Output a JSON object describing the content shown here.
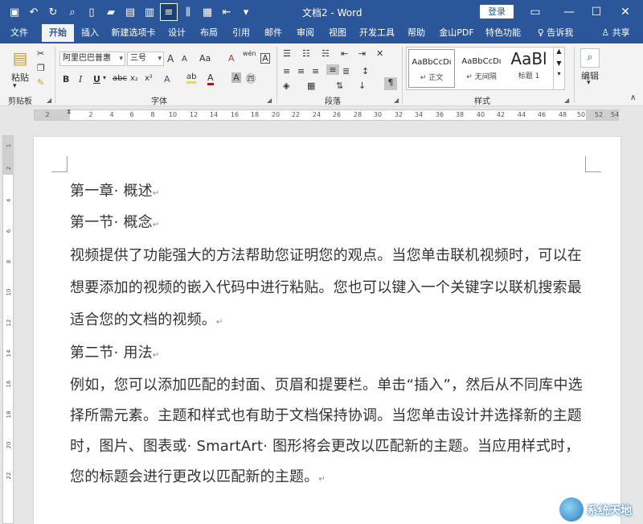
{
  "title_bar": {
    "doc_title": "文档2 - Word",
    "login_label": "登录",
    "restore_icon": "▭",
    "minimize_icon": "—",
    "maximize_icon": "☐",
    "close_icon": "✕"
  },
  "tabs": [
    "文件",
    "开始",
    "插入",
    "新建选项卡",
    "设计",
    "布局",
    "引用",
    "邮件",
    "审阅",
    "视图",
    "开发工具",
    "帮助",
    "金山PDF",
    "特色功能"
  ],
  "tell_me": "告诉我",
  "share": "共享",
  "ribbon": {
    "clipboard": {
      "paste": "粘贴",
      "label": "剪贴板"
    },
    "font": {
      "label": "字体",
      "font_name": "阿里巴巴普惠",
      "font_size": "三号",
      "bold": "B",
      "italic": "I",
      "underline": "U",
      "strike": "abc",
      "sub": "x₂",
      "sup": "x²",
      "grow": "A",
      "shrink": "A",
      "case": "Aa",
      "clear": "A",
      "wen": "wén",
      "charborder": "A",
      "highlight": "ab",
      "color": "A",
      "shade": "A",
      "circle": "㊃"
    },
    "paragraph": {
      "label": "段落"
    },
    "styles": {
      "label": "样式",
      "items": [
        {
          "sample": "AaBbCcDı",
          "name": "↵ 正文"
        },
        {
          "sample": "AaBbCcDı",
          "name": "↵ 无间隔"
        },
        {
          "sample": "AaBl",
          "name": "标题 1"
        }
      ]
    },
    "editing": {
      "label": "编辑"
    }
  },
  "ruler": {
    "marks": [
      "2",
      "2",
      "4",
      "6",
      "8",
      "10",
      "12",
      "14",
      "16",
      "18",
      "20",
      "22",
      "24",
      "26",
      "28",
      "30",
      "32",
      "34",
      "36",
      "38",
      "40",
      "42",
      "44",
      "46",
      "48",
      "50",
      "52",
      "54"
    ],
    "vmarks": [
      "1",
      "2",
      "4",
      "6",
      "8",
      "10",
      "12",
      "14",
      "16",
      "18",
      "20",
      "22"
    ]
  },
  "document": {
    "paragraphs": [
      "第一章· 概述",
      "第一节· 概念",
      "视频提供了功能强大的方法帮助您证明您的观点。当您单击联机视频时，可以在想要添加的视频的嵌入代码中进行粘贴。您也可以键入一个关键字以联机搜索最适合您的文档的视频。",
      "第二节· 用法",
      "例如，您可以添加匹配的封面、页眉和提要栏。单击“插入”，然后从不同库中选择所需元素。主题和样式也有助于文档保持协调。当您单击设计并选择新的主题时，图片、图表或· SmartArt· 图形将会更改以匹配新的主题。当应用样式时，您的标题会进行更改以匹配新的主题。"
    ],
    "para_mark": "↵"
  },
  "watermark": "系统天地"
}
